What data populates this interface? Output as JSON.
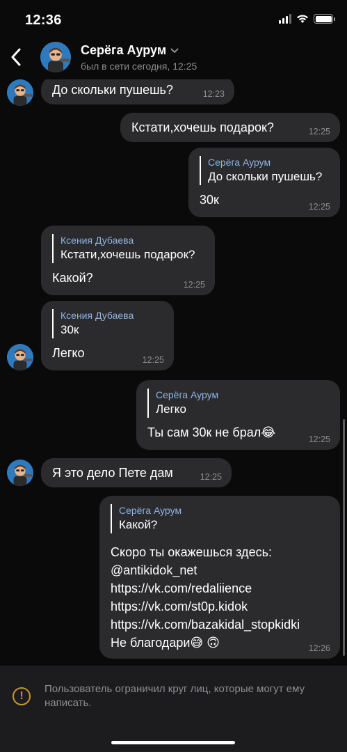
{
  "status_bar": {
    "time": "12:36"
  },
  "header": {
    "name": "Серёга Аурум",
    "status": "был в сети сегодня, 12:25"
  },
  "messages": [
    {
      "text": "До скольки пушешь?",
      "time": "12:23"
    },
    {
      "text": "Кстати,хочешь подарок?",
      "time": "12:25"
    },
    {
      "quote_author": "Серёга Аурум",
      "quote_text": "До скольки пушешь?",
      "text": "30к",
      "time": "12:25"
    },
    {
      "quote_author": "Ксения Дубаева",
      "quote_text": "Кстати,хочешь подарок?",
      "text": "Какой?",
      "time": "12:25"
    },
    {
      "quote_author": "Ксения Дубаева",
      "quote_text": "30к",
      "text": "Легко",
      "time": "12:25"
    },
    {
      "quote_author": "Серёга Аурум",
      "quote_text": "Легко",
      "text": "Ты сам 30к не брал",
      "emoji": "😂",
      "time": "12:25"
    },
    {
      "text": "Я это дело Пете дам",
      "time": "12:25"
    },
    {
      "quote_author": "Серёга Аурум",
      "quote_text": "Какой?",
      "line1": "Скоро ты окажешься здесь:",
      "links": [
        "@antikidok_net",
        "https://vk.com/redaliience",
        "https://vk.com/st0p.kidok",
        "https://vk.com/bazakidal_stopkidki"
      ],
      "last_line": "Не благодари",
      "emojis": "😅 🙃",
      "time": "12:26"
    }
  ],
  "footer": {
    "notice": "Пользователь ограничил круг лиц, которые могут ему написать.",
    "icon": "warning-icon"
  },
  "colors": {
    "accent_link": "#78a9e6",
    "quote_author": "#8fb3e5",
    "warning": "#c89434"
  }
}
